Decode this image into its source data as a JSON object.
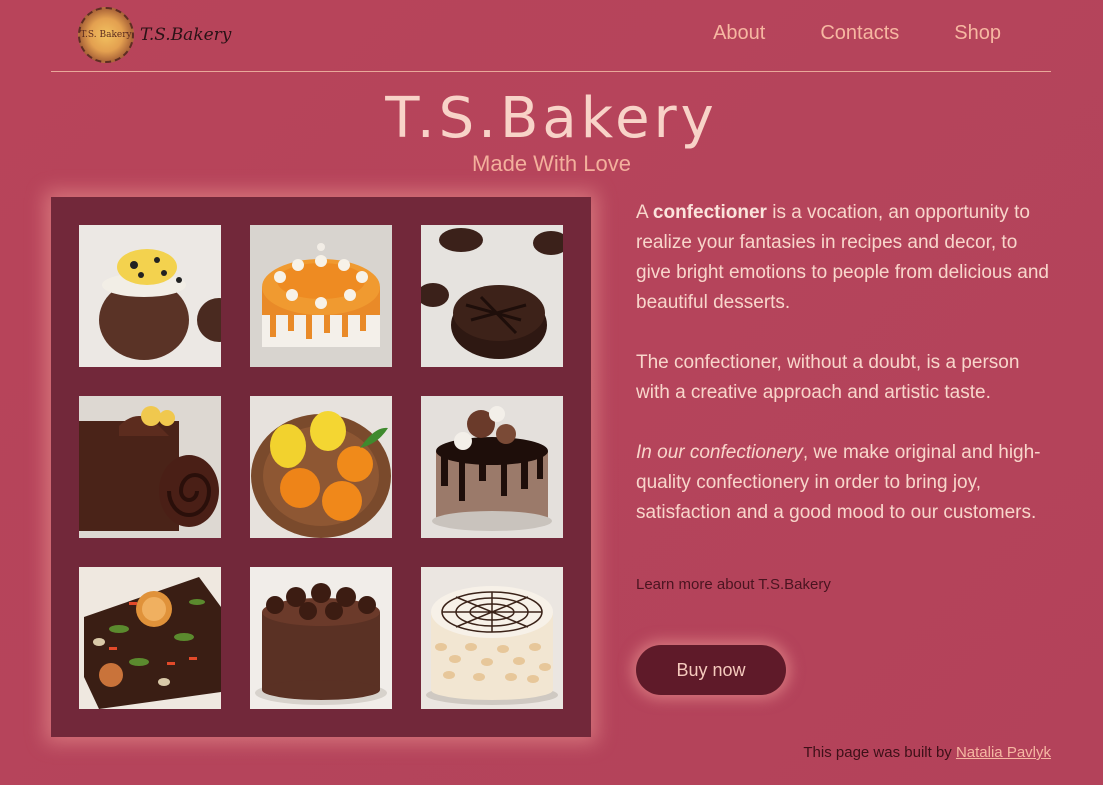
{
  "header": {
    "logo_small_text": "T.S. Bakery",
    "logo_text": "T.S.Bakery",
    "nav": [
      {
        "label": "About"
      },
      {
        "label": "Contacts"
      },
      {
        "label": "Shop"
      }
    ]
  },
  "hero": {
    "title": "T.S.Bakery",
    "subtitle": "Made With Love"
  },
  "gallery": {
    "photos": [
      {
        "icon": "chocolate-cup-dessert"
      },
      {
        "icon": "orange-meringue-cake"
      },
      {
        "icon": "chocolate-cookie"
      },
      {
        "icon": "chocolate-roll"
      },
      {
        "icon": "lemons-and-tangerines"
      },
      {
        "icon": "chocolate-drip-cake"
      },
      {
        "icon": "decorated-chocolate-loaf"
      },
      {
        "icon": "chocolate-rosette-cake"
      },
      {
        "icon": "almond-cake"
      }
    ]
  },
  "content": {
    "p1_prefix": "A ",
    "p1_bold": "confectioner",
    "p1_rest": " is a vocation, an opportunity to realize your fantasies in recipes and decor, to give bright emotions to people from delicious and beautiful desserts.",
    "p2": "The confectioner, without a doubt, is a person with a creative approach and artistic taste.",
    "p3_italic": "In our confectionery",
    "p3_rest": ", we make original and high-quality confectionery in order to bring joy, satisfaction and a good mood to our customers.",
    "learn_more": "Learn more about T.S.Bakery",
    "buy_label": "Buy now"
  },
  "footer": {
    "prefix": "This page was built by ",
    "author": "Natalia Pavlyk"
  },
  "colors": {
    "background": "#b5445b",
    "gallery_bg": "#72283a",
    "button_bg": "#5f1a29",
    "accent": "#f6b7a1"
  }
}
